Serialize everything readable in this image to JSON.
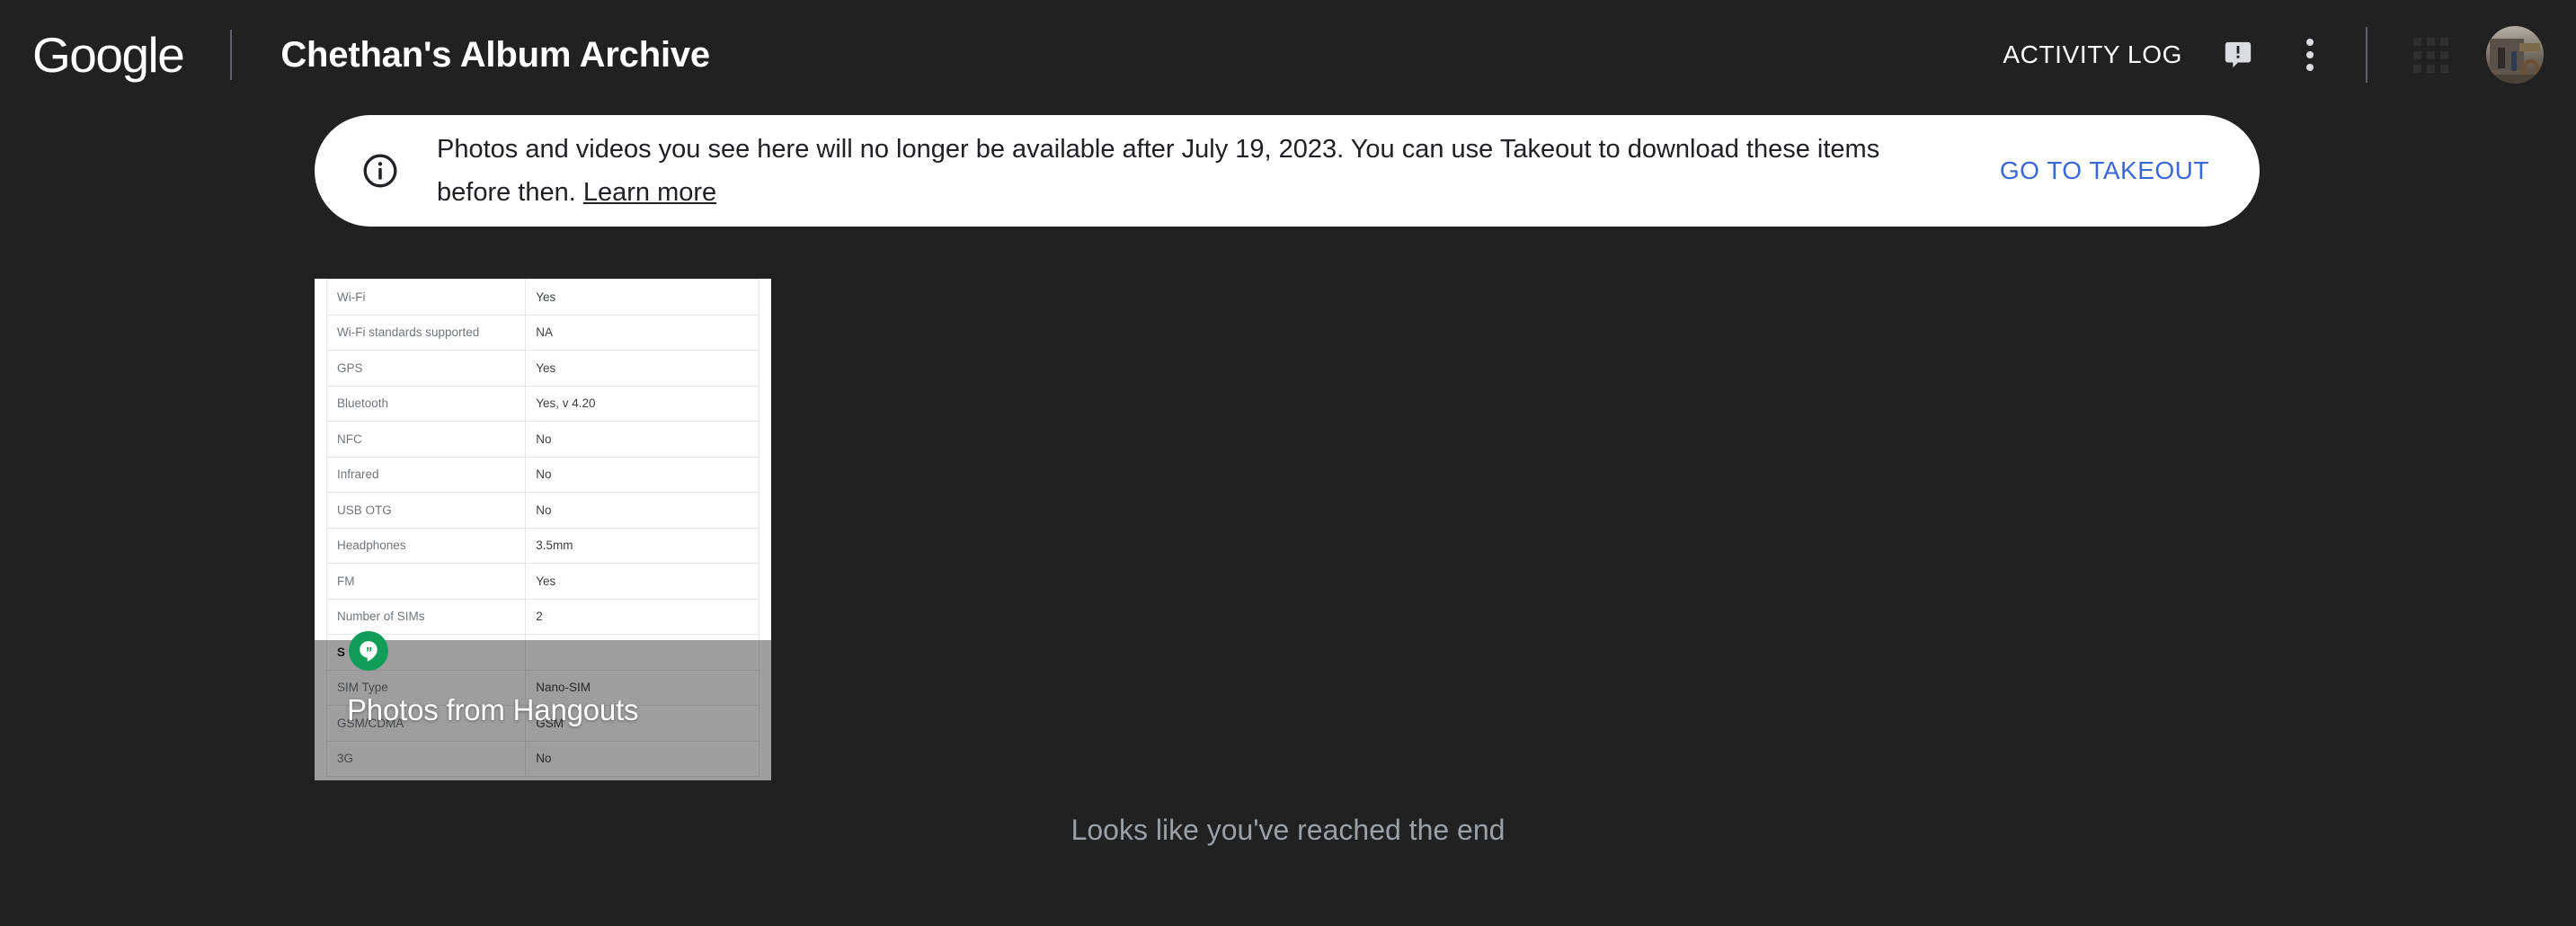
{
  "header": {
    "logo_text": "Google",
    "app_title": "Chethan's Album Archive",
    "activity_log_label": "ACTIVITY LOG",
    "feedback_icon": "feedback-speech-bubble-icon",
    "more_icon": "three-dot-menu-icon",
    "apps_icon": "apps-grid-icon",
    "avatar_icon": "user-avatar"
  },
  "banner": {
    "info_icon": "info-circle-icon",
    "message_part1": "Photos and videos you see here will no longer be available after July 19, 2023. You can use Takeout to download these items before then. ",
    "learn_more_label": "Learn more",
    "action_label": "GO TO TAKEOUT",
    "action_color": "#3b68d4",
    "background_color": "#ffffff"
  },
  "album": {
    "title": "Photos from Hangouts",
    "source_icon": "hangouts-icon",
    "source_color": "#0f9d58",
    "thumbnail_alt": "phone specification table",
    "spec_rows": [
      {
        "label": "Wi-Fi",
        "value": "Yes",
        "section": false
      },
      {
        "label": "Wi-Fi standards supported",
        "value": "NA",
        "section": false
      },
      {
        "label": "GPS",
        "value": "Yes",
        "section": false
      },
      {
        "label": "Bluetooth",
        "value": "Yes, v 4.20",
        "section": false
      },
      {
        "label": "NFC",
        "value": "No",
        "section": false
      },
      {
        "label": "Infrared",
        "value": "No",
        "section": false
      },
      {
        "label": "USB OTG",
        "value": "No",
        "section": false
      },
      {
        "label": "Headphones",
        "value": "3.5mm",
        "section": false
      },
      {
        "label": "FM",
        "value": "Yes",
        "section": false
      },
      {
        "label": "Number of SIMs",
        "value": "2",
        "section": false
      },
      {
        "label": "S",
        "value": "",
        "section": true
      },
      {
        "label": "SIM Type",
        "value": "Nano-SIM",
        "section": false
      },
      {
        "label": "GSM/CDMA",
        "value": "GSM",
        "section": false
      },
      {
        "label": "3G",
        "value": "No",
        "section": false
      }
    ]
  },
  "footer": {
    "end_message": "Looks like you've reached the end"
  },
  "theme": {
    "background": "#212121",
    "text_primary": "#ffffff",
    "text_muted": "#9aa0a6"
  }
}
